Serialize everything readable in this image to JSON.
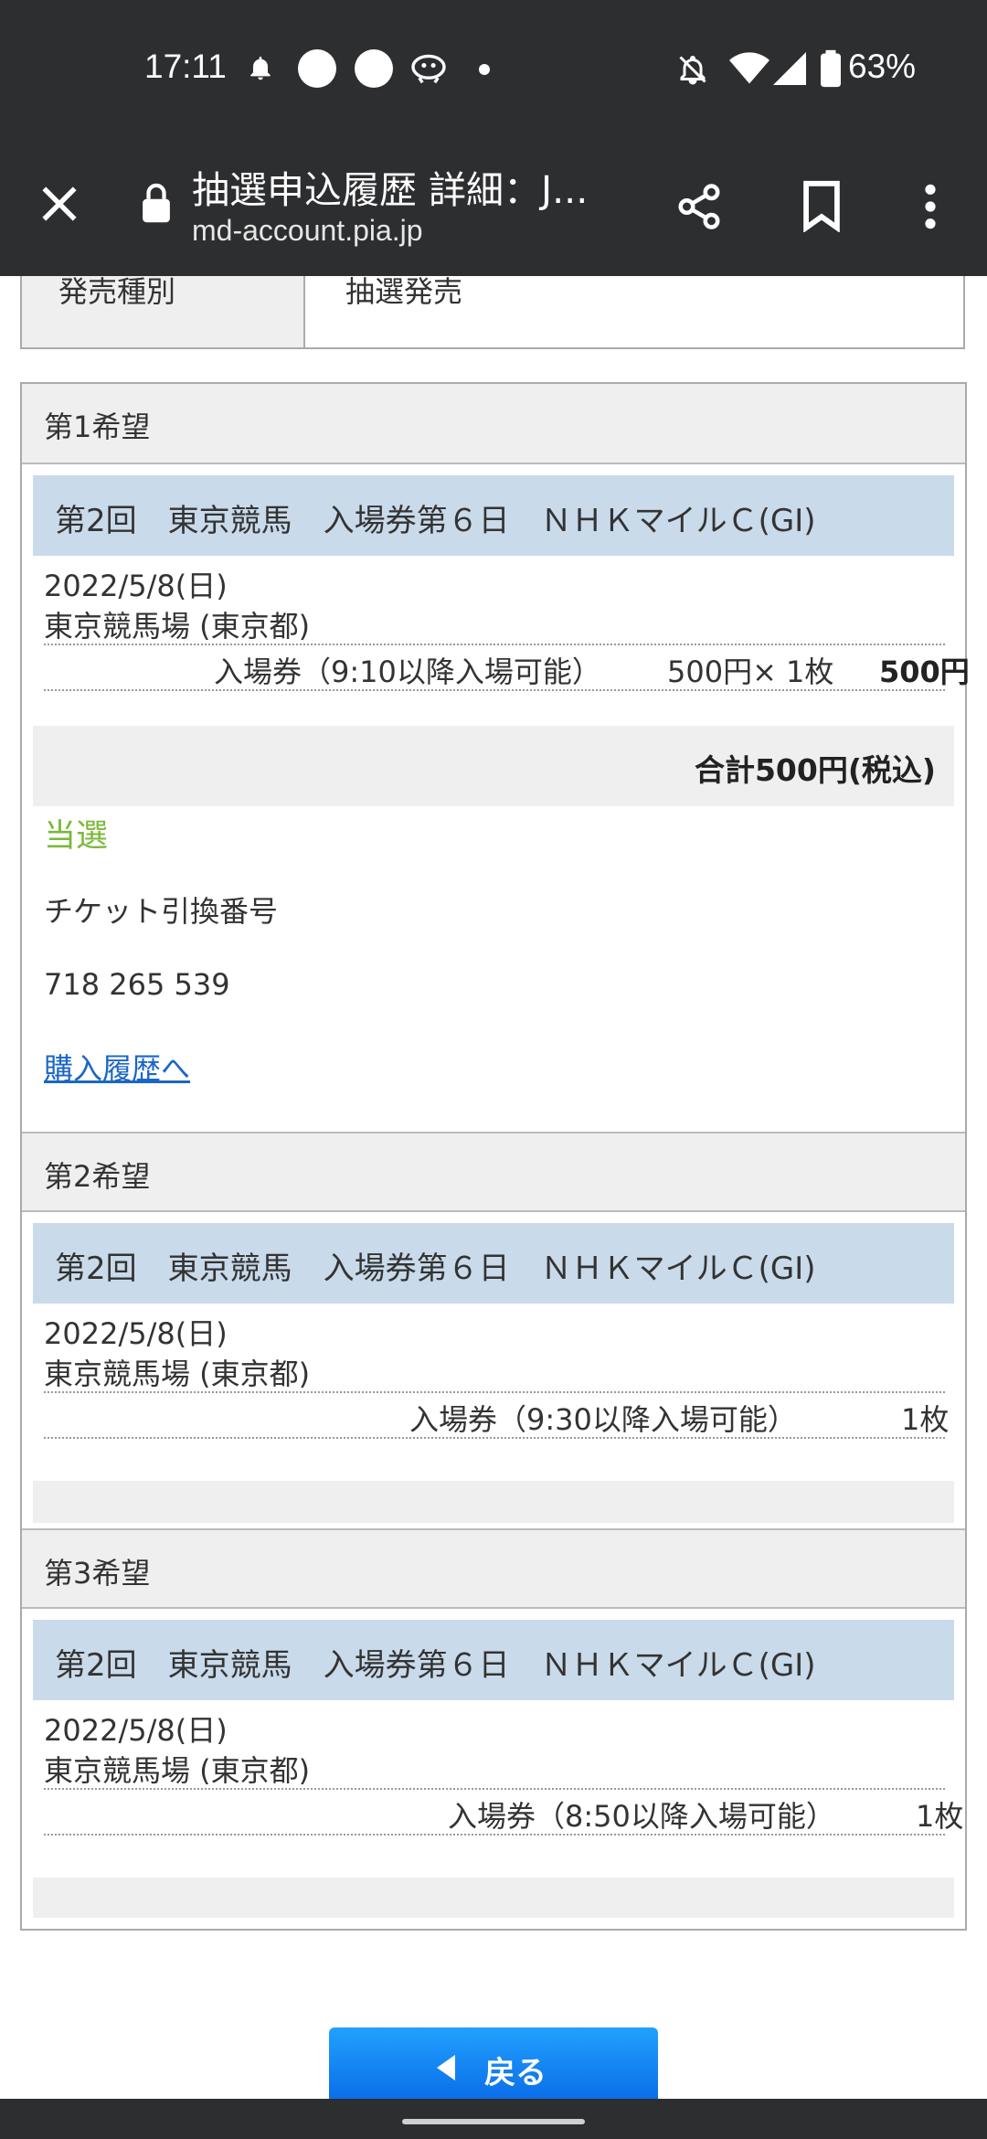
{
  "status_bar": {
    "time": "17:11",
    "battery": "63%"
  },
  "browser": {
    "title": "抽選申込履歴 詳細：J...",
    "url": "md-account.pia.jp"
  },
  "sale_type": {
    "label": "発売種別",
    "value": "抽選発売"
  },
  "wishes": [
    {
      "heading": "第1希望",
      "event": "第2回　東京競馬　入場券第６日　ＮＨＫマイルＣ(GI)",
      "date": "2022/5/8(日)",
      "venue": "東京競馬場 (東京都)",
      "ticket": "入場券（9:10以降入場可能）",
      "unit_price": "500円×",
      "count": "1枚",
      "amount": "500円",
      "total": "合計500円(税込)",
      "result": "当選",
      "exchange_label": "チケット引換番号",
      "exchange_number": "718 265 539",
      "history_link": "購入履歴へ"
    },
    {
      "heading": "第2希望",
      "event": "第2回　東京競馬　入場券第６日　ＮＨＫマイルＣ(GI)",
      "date": "2022/5/8(日)",
      "venue": "東京競馬場 (東京都)",
      "ticket": "入場券（9:30以降入場可能）",
      "count": "1枚"
    },
    {
      "heading": "第3希望",
      "event": "第2回　東京競馬　入場券第６日　ＮＨＫマイルＣ(GI)",
      "date": "2022/5/8(日)",
      "venue": "東京競馬場 (東京都)",
      "ticket": "入場券（8:50以降入場可能）",
      "count": "1枚"
    }
  ],
  "back_button": "戻る",
  "colors": {
    "accent_blue": "#0a6de8",
    "win_green": "#7bb83a",
    "event_bar": "#c9daea",
    "link": "#1a66c7"
  },
  "icons": {
    "close": "close-icon",
    "lock": "lock-icon",
    "share": "share-icon",
    "bookmark": "bookmark-icon",
    "more": "more-vert-icon"
  }
}
